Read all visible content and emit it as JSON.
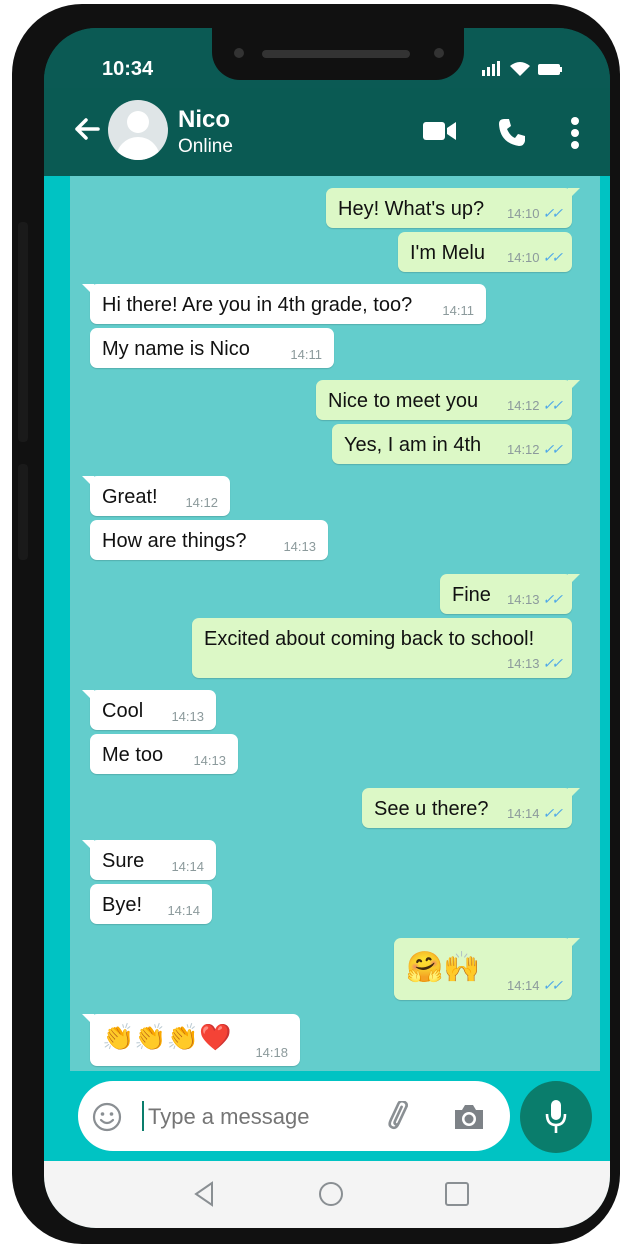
{
  "status_bar": {
    "time": "10:34"
  },
  "header": {
    "back_icon": "arrow-left-icon",
    "name": "Nico",
    "status": "Online",
    "video_icon": "video-camera-icon",
    "call_icon": "phone-icon",
    "menu_icon": "more-vertical-icon"
  },
  "colors": {
    "header": "#0a5a53",
    "chat_bg": "#63cdcc",
    "outgoing": "#dcf8c6",
    "incoming": "#ffffff",
    "tick": "#4fa8e8"
  },
  "messages": [
    {
      "dir": "out",
      "text": "Hey! What's up?",
      "time": "14:10"
    },
    {
      "dir": "out",
      "text": "I'm Melu",
      "time": "14:10"
    },
    {
      "dir": "in",
      "text": "Hi there! Are you in 4th grade, too?",
      "time": "14:11"
    },
    {
      "dir": "in",
      "text": "My name is Nico",
      "time": "14:11"
    },
    {
      "dir": "out",
      "text": "Nice to meet you",
      "time": "14:12"
    },
    {
      "dir": "out",
      "text": "Yes, I am in 4th",
      "time": "14:12"
    },
    {
      "dir": "in",
      "text": "Great!",
      "time": "14:12"
    },
    {
      "dir": "in",
      "text": "How are things?",
      "time": "14:13"
    },
    {
      "dir": "out",
      "text": "Fine",
      "time": "14:13"
    },
    {
      "dir": "out",
      "text": "Excited about coming back to school!",
      "time": "14:13"
    },
    {
      "dir": "in",
      "text": "Cool",
      "time": "14:13"
    },
    {
      "dir": "in",
      "text": "Me too",
      "time": "14:13"
    },
    {
      "dir": "out",
      "text": "See u there?",
      "time": "14:14"
    },
    {
      "dir": "in",
      "text": "Sure",
      "time": "14:14"
    },
    {
      "dir": "in",
      "text": "Bye!",
      "time": "14:14"
    },
    {
      "dir": "out",
      "text": "🤗🙌",
      "time": "14:14"
    },
    {
      "dir": "in",
      "text": "👏👏👏❤️",
      "time": "14:18"
    }
  ],
  "composer": {
    "placeholder": "Type a message",
    "emoji_icon": "emoji-icon",
    "attach_icon": "paperclip-icon",
    "camera_icon": "camera-icon",
    "mic_icon": "microphone-icon"
  },
  "nav": {
    "back": "nav-back-icon",
    "home": "nav-home-icon",
    "recents": "nav-recents-icon"
  }
}
